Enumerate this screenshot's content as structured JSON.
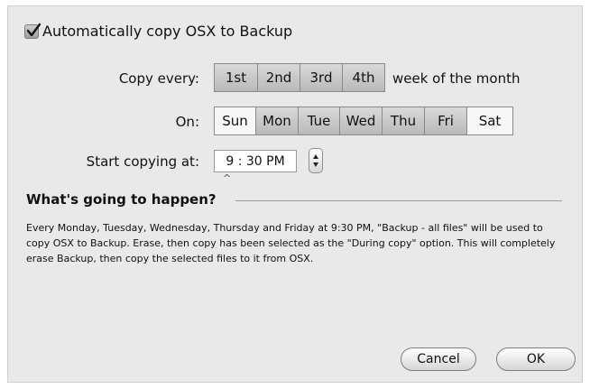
{
  "auto_copy": {
    "checked": true,
    "label": "Automatically copy OSX to Backup"
  },
  "copy_every": {
    "label": "Copy every:",
    "weeks": [
      {
        "label": "1st",
        "selected": true
      },
      {
        "label": "2nd",
        "selected": true
      },
      {
        "label": "3rd",
        "selected": true
      },
      {
        "label": "4th",
        "selected": true
      }
    ],
    "suffix": "week of the month"
  },
  "on": {
    "label": "On:",
    "days": [
      {
        "label": "Sun",
        "selected": false
      },
      {
        "label": "Mon",
        "selected": true
      },
      {
        "label": "Tue",
        "selected": true
      },
      {
        "label": "Wed",
        "selected": true
      },
      {
        "label": "Thu",
        "selected": true
      },
      {
        "label": "Fri",
        "selected": true
      },
      {
        "label": "Sat",
        "selected": false
      }
    ]
  },
  "start": {
    "label": "Start copying at:",
    "time": "9 : 30 PM"
  },
  "summary": {
    "title": "What's going to happen?",
    "text": "Every Monday, Tuesday, Wednesday, Thursday and Friday at 9:30 PM, \"Backup - all files\" will be used to copy OSX to Backup. Erase, then copy has been selected as the \"During copy\" option. This will completely erase Backup, then copy the selected files to it from OSX."
  },
  "buttons": {
    "cancel": "Cancel",
    "ok": "OK"
  }
}
